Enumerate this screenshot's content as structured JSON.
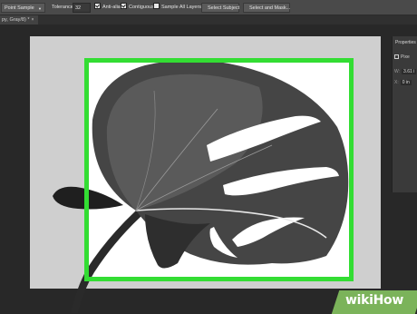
{
  "options_bar": {
    "sample_select": "Point Sample",
    "tolerance_label": "Tolerance:",
    "tolerance_value": "32",
    "anti_alias_label": "Anti-alias",
    "anti_alias_checked": true,
    "contiguous_label": "Contiguous",
    "contiguous_checked": true,
    "sample_all_layers_label": "Sample All Layers",
    "sample_all_layers_checked": false,
    "select_subject_label": "Select Subject",
    "select_and_mask_label": "Select and Mask..."
  },
  "document_tab": {
    "title": "py, Gray/8) *",
    "close_glyph": "×"
  },
  "properties_panel": {
    "title": "Properties",
    "pixel_label": "Pixe",
    "width_label": "W:",
    "width_value": "3.61 i",
    "x_label": "X:",
    "x_value": "0 in"
  },
  "selection": {
    "color": "#33dd33"
  },
  "watermark": {
    "text": "wikiHow",
    "color": "#7bb35a"
  }
}
